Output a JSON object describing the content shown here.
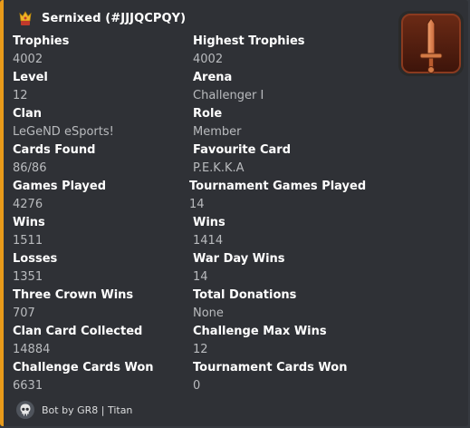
{
  "author": {
    "name": "Sernixed (#JJJQCPQY)",
    "icon": "clash-royale-king-icon"
  },
  "thumbnail": {
    "icon": "sword-badge-icon"
  },
  "fields": [
    {
      "name": "Trophies",
      "value": "4002"
    },
    {
      "name": "Highest Trophies",
      "value": "4002"
    },
    {
      "name": "Level",
      "value": "12"
    },
    {
      "name": "Arena",
      "value": "Challenger I"
    },
    {
      "name": "Clan",
      "value": "LeGeND eSports!"
    },
    {
      "name": "Role",
      "value": "Member"
    },
    {
      "name": "Cards Found",
      "value": "86/86"
    },
    {
      "name": "Favourite Card",
      "value": "P.E.K.K.A"
    },
    {
      "name": "Games Played",
      "value": "4276"
    },
    {
      "name": "Tournament Games Played",
      "value": "14"
    },
    {
      "name": "Wins",
      "value": "1511"
    },
    {
      "name": "Wins",
      "value": "1414"
    },
    {
      "name": "Losses",
      "value": "1351"
    },
    {
      "name": "War Day Wins",
      "value": "14"
    },
    {
      "name": "Three Crown Wins",
      "value": "707"
    },
    {
      "name": "Total Donations",
      "value": "None"
    },
    {
      "name": "Clan Card Collected",
      "value": "14884"
    },
    {
      "name": "Challenge Max Wins",
      "value": "12"
    },
    {
      "name": "Challenge Cards Won",
      "value": "6631"
    },
    {
      "name": "Tournament Cards Won",
      "value": "0"
    }
  ],
  "footer": {
    "text": "Bot by GR8 | Titan",
    "icon": "skull-icon"
  },
  "colors": {
    "accent": "#e89a1a",
    "embed_bg": "#2f3136",
    "page_bg": "#36393f"
  }
}
